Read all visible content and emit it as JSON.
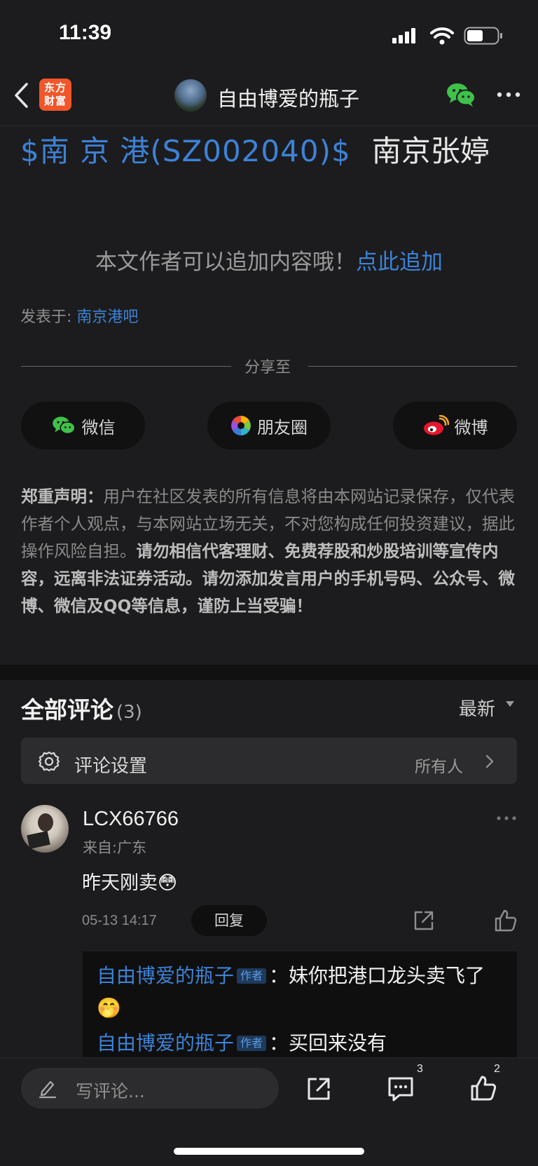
{
  "status_bar": {
    "time": "11:39"
  },
  "header": {
    "app_logo_text": "东方财富",
    "title": "自由博爱的瓶子"
  },
  "article": {
    "stock_link": "$南 京 港(SZ002040)$",
    "stock_suffix": "南京张婷",
    "append_prompt": "本文作者可以追加内容哦！",
    "append_link": "点此追加",
    "posted_label": "发表于:",
    "posted_forum": "南京港吧"
  },
  "share": {
    "label": "分享至",
    "buttons": [
      {
        "label": "微信",
        "icon": "wechat-icon"
      },
      {
        "label": "朋友圈",
        "icon": "moments-icon"
      },
      {
        "label": "微博",
        "icon": "weibo-icon"
      }
    ]
  },
  "disclaimer": {
    "heading": "郑重声明：",
    "text": "用户在社区发表的所有信息将由本网站记录保存，仅代表作者个人观点，与本网站立场无关，不对您构成任何投资建议，据此操作风险自担。",
    "bold_text": "请勿相信代客理财、免费荐股和炒股培训等宣传内容，远离非法证券活动。请勿添加发言用户的手机号码、公众号、微博、微信及QQ等信息，谨防上当受骗！"
  },
  "comments": {
    "title": "全部评论",
    "count": "(3)",
    "sort": "最新",
    "settings_label": "评论设置",
    "settings_value": "所有人",
    "items": [
      {
        "user": "LCX66766",
        "location": "来自:广东",
        "text": "昨天刚卖",
        "emoji": "😳",
        "time": "05-13 14:17",
        "reply_label": "回复",
        "replies": [
          {
            "user": "自由博爱的瓶子",
            "tag": "作者",
            "text": "妹你把港口龙头卖飞了",
            "emoji": "🤭"
          },
          {
            "user": "自由博爱的瓶子",
            "tag": "作者",
            "text": "买回来没有"
          }
        ]
      }
    ]
  },
  "bottom_bar": {
    "input_placeholder": "写评论...",
    "comment_count": "3",
    "like_count": "2"
  },
  "colors": {
    "background": "#1c1c1e",
    "link_blue": "#3d82d6",
    "wechat_green": "#3fc24a",
    "logo_orange": "#f0562a"
  }
}
